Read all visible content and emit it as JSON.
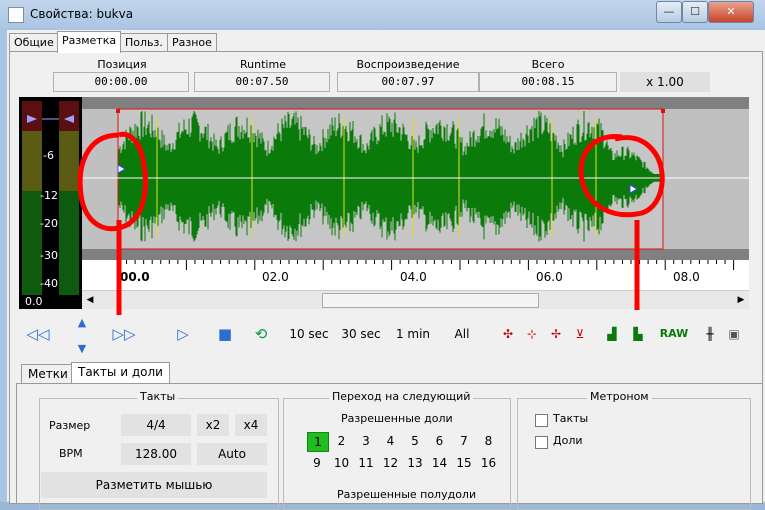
{
  "window": {
    "title": "Свойства: bukva"
  },
  "titlebar_buttons": {
    "minimize": "—",
    "maximize": "☐",
    "close": "✕"
  },
  "tabs": [
    "Общие",
    "Разметка",
    "Польз.",
    "Разное"
  ],
  "header": {
    "position_label": "Позиция",
    "position_value": "00:00.00",
    "runtime_label": "Runtime",
    "runtime_value": "00:07.50",
    "playback_label": "Воспроизведение",
    "playback_value": "00:07.97",
    "total_label": "Всего",
    "total_value": "00:08.15",
    "zoom": "x 1.00"
  },
  "vu": {
    "ticks": [
      "-6",
      "-12",
      "-20",
      "-30",
      "-40"
    ],
    "readout": "0.0"
  },
  "ruler": {
    "labels": [
      "00.0",
      "02.0",
      "04.0",
      "06.0",
      "08.0"
    ]
  },
  "toolbar": {
    "rewind": "◁◁",
    "up": "▲",
    "down": "▼",
    "forward": "▷▷",
    "play": "▷",
    "stop": "■",
    "loop": "⟲",
    "ten_sec": "10 sec",
    "thirty_sec": "30 sec",
    "one_min": "1 min",
    "all": "All",
    "raw": "RAW"
  },
  "lower_tabs": [
    "Метки",
    "Такты и доли"
  ],
  "beats": {
    "title": "Такты",
    "size_label": "Размер",
    "size_value": "4/4",
    "x2": "x2",
    "x4": "x4",
    "bpm_label": "BPM",
    "bpm_value": "128.00",
    "auto": "Auto",
    "mark_mouse": "Разметить мышью"
  },
  "transition": {
    "title": "Переход на следующий",
    "allowed_beats": "Разрешенные доли",
    "beats": [
      "1",
      "2",
      "3",
      "4",
      "5",
      "6",
      "7",
      "8",
      "9",
      "10",
      "11",
      "12",
      "13",
      "14",
      "15",
      "16"
    ],
    "selected": "1",
    "allowed_half": "Разрешенные полудоли"
  },
  "metronome": {
    "title": "Метроном",
    "bars": "Такты",
    "beats": "Доли"
  },
  "colors": {
    "wave": "#0a7a0a",
    "selection": "#e01010",
    "annotation": "#ff0000",
    "active_beat": "#22bb22"
  }
}
